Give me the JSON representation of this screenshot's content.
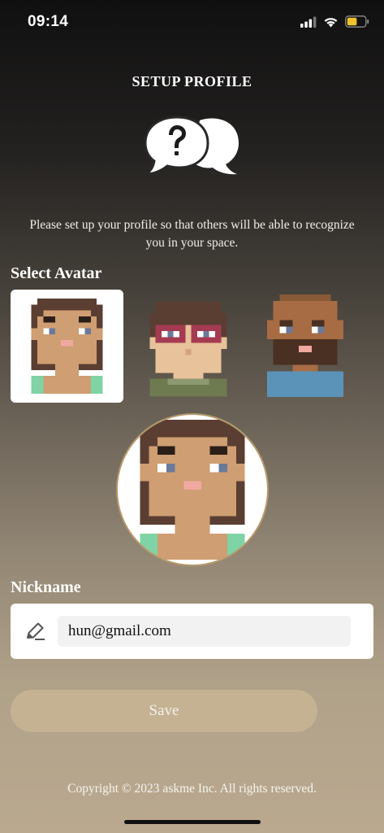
{
  "status_bar": {
    "time": "09:14",
    "icons": [
      "signal-icon",
      "wifi-icon",
      "battery-icon"
    ],
    "battery_level": 0.55,
    "battery_color": "#f2c12e"
  },
  "header": {
    "title": "SETUP PROFILE",
    "icon": "question-chat-bubbles-icon"
  },
  "intro_text": "Please set up your profile so that others will be able to recognize you in your space.",
  "avatar_section": {
    "label": "Select Avatar",
    "avatars": [
      {
        "name": "avatar-long-hair",
        "selected": true
      },
      {
        "name": "avatar-glasses",
        "selected": false
      },
      {
        "name": "avatar-beard",
        "selected": false
      }
    ]
  },
  "preview": {
    "avatar": "avatar-long-hair"
  },
  "nickname": {
    "label": "Nickname",
    "value": "hun@gmail.com",
    "icon": "pencil-icon"
  },
  "save_label": "Save",
  "footer": {
    "copyright": "Copyright © 2023 askme Inc. All rights reserved."
  },
  "colors": {
    "accent": "#c4b293",
    "preview_border": "#b69a6a"
  }
}
